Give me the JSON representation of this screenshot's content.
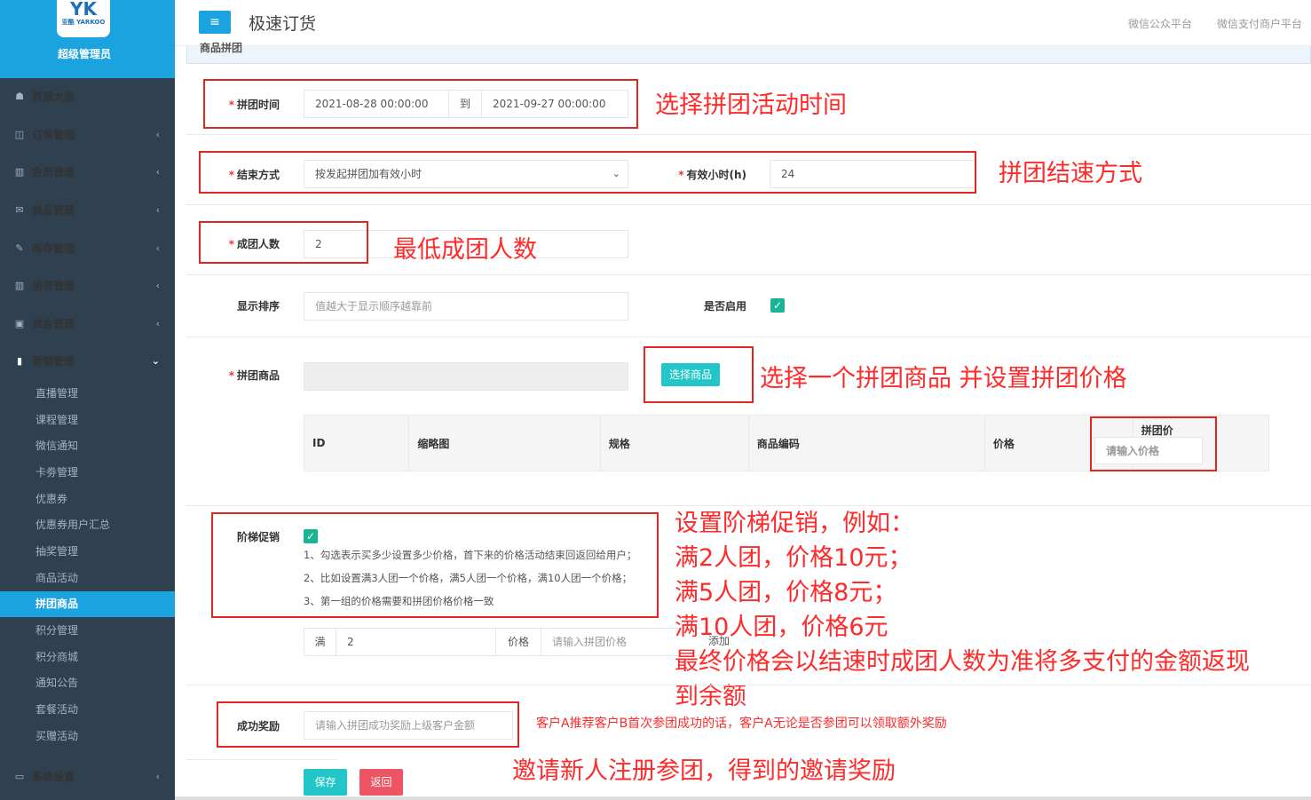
{
  "brand": {
    "logo_big": "YK",
    "logo_small": "亚酷 YARKOO",
    "title": "超级管理员"
  },
  "header": {
    "menu_toggle": "≡",
    "title": "极速订货",
    "link1": "微信公众平台",
    "link2": "微信支付商户平台"
  },
  "sidebar": {
    "items": [
      {
        "icon": "dashboard-icon",
        "glyph": "☗",
        "label": "数据大盘",
        "chev": ""
      },
      {
        "icon": "order-icon",
        "glyph": "◫",
        "label": "订单管理",
        "chev": "‹"
      },
      {
        "icon": "member-icon",
        "glyph": "▥",
        "label": "会员管理",
        "chev": "‹"
      },
      {
        "icon": "product-icon",
        "glyph": "✉",
        "label": "商品管理",
        "chev": "‹"
      },
      {
        "icon": "inventory-icon",
        "glyph": "✎",
        "label": "库存管理",
        "chev": "‹"
      },
      {
        "icon": "report-icon",
        "glyph": "▥",
        "label": "报表管理",
        "chev": "‹"
      },
      {
        "icon": "finance-icon",
        "glyph": "▣",
        "label": "资金管理",
        "chev": "‹"
      },
      {
        "icon": "marketing-icon",
        "glyph": "▮",
        "label": "营销管理",
        "chev": "⌄"
      }
    ],
    "sub_items": [
      "直播管理",
      "课程管理",
      "微信通知",
      "卡劵管理",
      "优惠券",
      "优惠券用户汇总",
      "抽奖管理",
      "商品活动",
      "拼团商品",
      "积分管理",
      "积分商城",
      "通知公告",
      "套餐活动",
      "买赠活动"
    ],
    "active_sub": "拼团商品",
    "settings": {
      "icon": "monitor-icon",
      "glyph": "▭",
      "label": "系统设置",
      "chev": "‹"
    }
  },
  "panel": {
    "title": "商品拼团"
  },
  "form": {
    "time_label": "拼团时间",
    "time_start": "2021-08-28 00:00:00",
    "time_to": "到",
    "time_end": "2021-09-27 00:00:00",
    "end_mode_label": "结束方式",
    "end_mode_value": "按发起拼团加有效小时",
    "valid_hours_label": "有效小时(h)",
    "valid_hours_value": "24",
    "group_size_label": "成团人数",
    "group_size_value": "2",
    "sort_label": "显示排序",
    "sort_placeholder": "值越大于显示顺序越靠前",
    "enabled_label": "是否启用",
    "goods_label": "拼团商品",
    "select_goods_button": "选择商品",
    "table_headers": [
      "ID",
      "缩略图",
      "规格",
      "商品编码",
      "价格"
    ],
    "group_price_header": "拼团价",
    "group_price_placeholder": "请输入价格",
    "tier_label": "阶梯促销",
    "tier_notes": [
      "1、勾选表示买多少设置多少价格，首下来的价格活动结束回返回给用户；",
      "2、比如设置满3人团一个价格，满5人团一个价格，满10人团一个价格；",
      "3、第一组的价格需要和拼团价格价格一致"
    ],
    "tier_full": "满",
    "tier_count": "2",
    "tier_price_label": "价格",
    "tier_price_placeholder": "请输入拼团价格",
    "tier_add": "添加",
    "reward_label": "成功奖励",
    "reward_placeholder": "请输入拼团成功奖励上级客户金额",
    "save_button": "保存",
    "back_button": "返回"
  },
  "annotations": {
    "a1": "选择拼团活动时间",
    "a2": "拼团结速方式",
    "a3": "最低成团人数",
    "a4": "选择一个拼团商品  并设置拼团价格",
    "a5": [
      "设置阶梯促销，例如：",
      "满2人团，价格10元；",
      "满5人团，价格8元；",
      "满10人团，价格6元",
      "最终价格会以结速时成团人数为准将多支付的金额返现",
      "到余额"
    ],
    "a6": "客户A推荐客户B首次参团成功的话，客户A无论是否参团可以领取额外奖励",
    "a7": "邀请新人注册参团，得到的邀请奖励"
  },
  "colors": {
    "accent": "#1ba3e0",
    "sidebar": "#2f4050",
    "teal": "#1ab394",
    "annotation": "#ff2a2a"
  }
}
